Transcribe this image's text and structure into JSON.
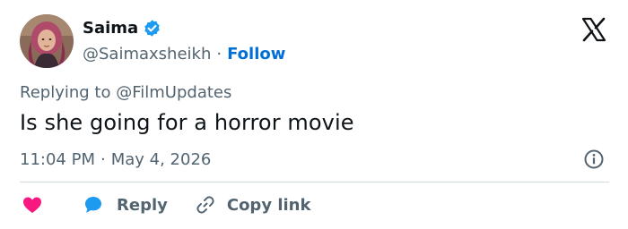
{
  "author": {
    "display_name": "Saima",
    "handle": "@Saimaxsheikh",
    "follow_label": "Follow",
    "separator": "·"
  },
  "reply_context": {
    "prefix": "Replying to",
    "mention": "@FilmUpdates"
  },
  "tweet": {
    "text": "Is she going for a horror movie",
    "time": "11:04 PM",
    "separator": "·",
    "date": "May 4, 2026"
  },
  "actions": {
    "reply_label": "Reply",
    "copy_link_label": "Copy link"
  },
  "icons": {
    "verified": "verified-badge-icon",
    "platform": "x-logo-icon",
    "info": "info-icon",
    "like": "heart-icon",
    "reply": "speech-bubble-icon",
    "copy_link": "link-icon"
  },
  "colors": {
    "accent": "#006fd6",
    "verified": "#1d9bf0",
    "heart": "#f91880",
    "text_primary": "#0f1419",
    "text_secondary": "#536471",
    "divider": "#cfd9de"
  }
}
